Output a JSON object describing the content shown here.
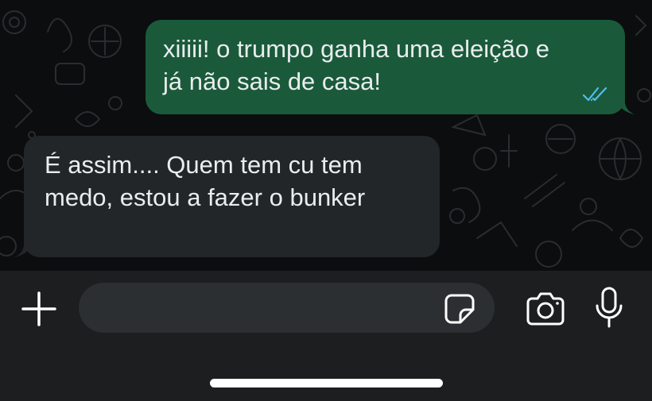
{
  "messages": [
    {
      "direction": "outgoing",
      "text_line1": "xiiiii! o trumpo ganha uma eleição e",
      "text_line2": "já não sais de casa!",
      "status": "read",
      "status_icon": "double-check-icon",
      "status_color": "#53bdeb"
    },
    {
      "direction": "incoming",
      "text_line1": "É assim.... Quem tem cu tem",
      "text_line2": "medo, estou a fazer o bunker"
    }
  ],
  "composer": {
    "input_value": "",
    "input_placeholder": "",
    "attach_icon": "plus-icon",
    "sticker_icon": "sticker-icon",
    "camera_icon": "camera-icon",
    "mic_icon": "microphone-icon"
  },
  "colors": {
    "chat_background": "#0b0d0e",
    "outgoing_bubble": "#1a5a3a",
    "incoming_bubble": "#232628",
    "composer_background": "#1c1e1f",
    "input_background": "#2c2f31",
    "text": "#e9edef"
  }
}
